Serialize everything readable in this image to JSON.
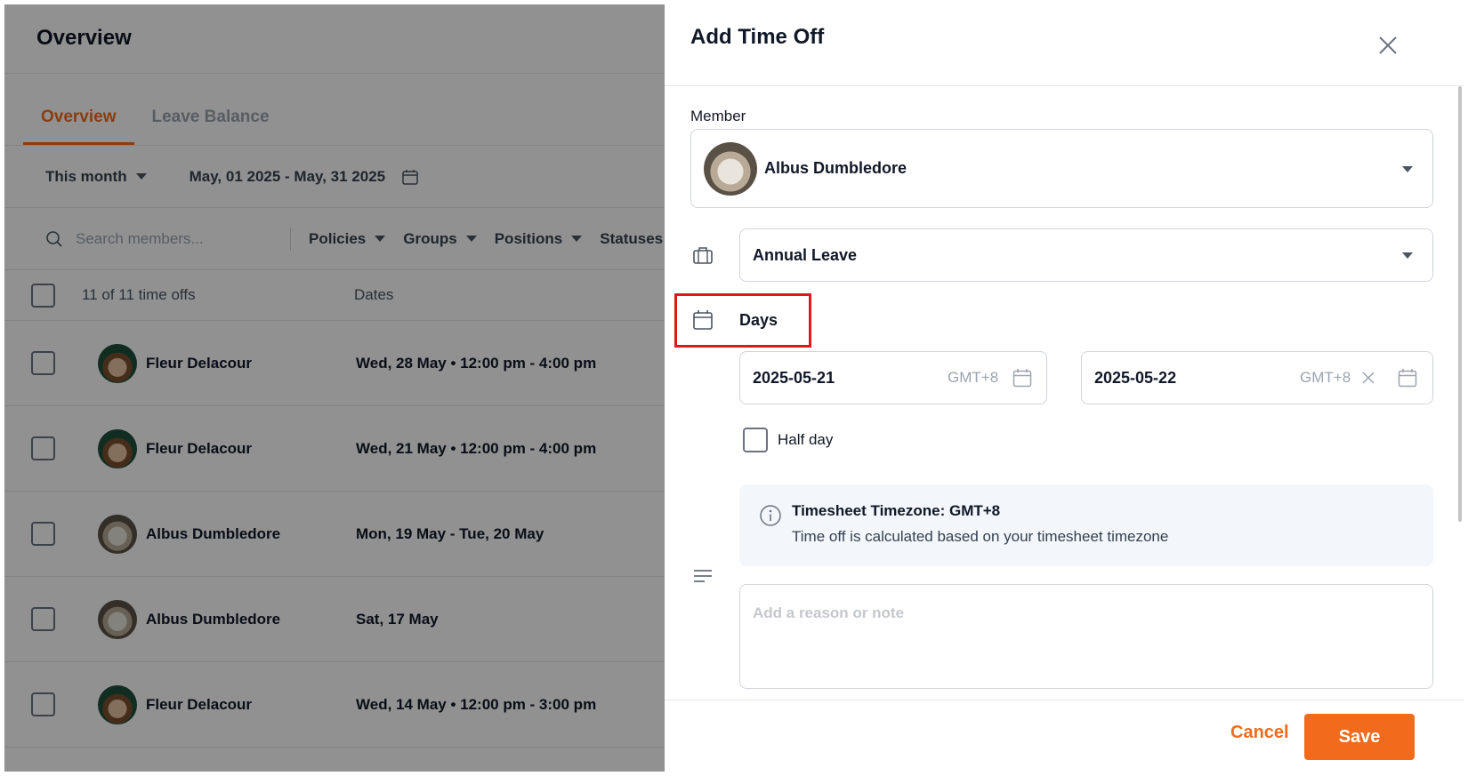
{
  "background": {
    "title": "Overview",
    "tabs": [
      {
        "label": "Overview",
        "active": true
      },
      {
        "label": "Leave Balance",
        "active": false
      }
    ],
    "period_label": "This month",
    "date_range": "May, 01 2025 - May, 31 2025",
    "search_placeholder": "Search members...",
    "filters": [
      "Policies",
      "Groups",
      "Positions",
      "Statuses"
    ],
    "count_label": "11 of 11 time offs",
    "dates_header": "Dates",
    "rows": [
      {
        "name": "Fleur Delacour",
        "dates": "Wed, 28 May • 12:00 pm - 4:00 pm",
        "avatar": "fleur"
      },
      {
        "name": "Fleur Delacour",
        "dates": "Wed, 21 May • 12:00 pm - 4:00 pm",
        "avatar": "fleur"
      },
      {
        "name": "Albus Dumbledore",
        "dates": "Mon, 19 May - Tue, 20 May",
        "avatar": "albus"
      },
      {
        "name": "Albus Dumbledore",
        "dates": "Sat, 17 May",
        "avatar": "albus"
      },
      {
        "name": "Fleur Delacour",
        "dates": "Wed, 14 May • 12:00 pm - 3:00 pm",
        "avatar": "fleur"
      }
    ]
  },
  "drawer": {
    "title": "Add Time Off",
    "member_label": "Member",
    "member_name": "Albus Dumbledore",
    "policy": "Annual Leave",
    "duration_mode": "Days",
    "start_date": "2025-05-21",
    "end_date": "2025-05-22",
    "start_tz": "GMT+8",
    "end_tz": "GMT+8",
    "half_day_label": "Half day",
    "timezone_title": "Timesheet Timezone: GMT+8",
    "timezone_text": "Time off is calculated based on your timesheet timezone",
    "note_placeholder": "Add a reason or note",
    "cancel_label": "Cancel",
    "save_label": "Save"
  },
  "colors": {
    "accent": "#f26b1d",
    "highlight": "#e0171f"
  }
}
